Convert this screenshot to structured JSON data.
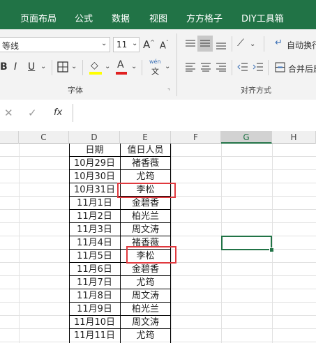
{
  "tabs": [
    "页面布局",
    "公式",
    "数据",
    "视图",
    "方方格子",
    "DIY工具箱"
  ],
  "ribbon": {
    "font_name": "等线",
    "font_size": "11",
    "bold": "B",
    "italic": "I",
    "underline": "U",
    "grow_font": "A",
    "shrink_font": "A",
    "phonetic_top": "wén",
    "phonetic_bottom": "文",
    "font_group_label": "字体",
    "align_group_label": "对齐方式",
    "wrap_text_label": "自动换行",
    "merge_center_label": "合并后居",
    "fill_color": "#ffff00",
    "font_color": "#e02020"
  },
  "formula_bar": {
    "cancel": "✕",
    "enter": "✓",
    "fx": "fx",
    "value": ""
  },
  "grid": {
    "columns": [
      "C",
      "D",
      "E",
      "F",
      "G",
      "H"
    ],
    "header": {
      "date": "日期",
      "person": "值日人员"
    },
    "rows": [
      {
        "date": "10月29日",
        "person": "褚香薇"
      },
      {
        "date": "10月30日",
        "person": "尤筠"
      },
      {
        "date": "10月31日",
        "person": "李松"
      },
      {
        "date": "11月1日",
        "person": "金碧香"
      },
      {
        "date": "11月2日",
        "person": "柏光兰"
      },
      {
        "date": "11月3日",
        "person": "周文涛"
      },
      {
        "date": "11月4日",
        "person": "褚香薇"
      },
      {
        "date": "11月5日",
        "person": "李松"
      },
      {
        "date": "11月6日",
        "person": "金碧香"
      },
      {
        "date": "11月7日",
        "person": "尤筠"
      },
      {
        "date": "11月8日",
        "person": "周文涛"
      },
      {
        "date": "11月9日",
        "person": "柏光兰"
      },
      {
        "date": "11月10日",
        "person": "周文涛"
      },
      {
        "date": "11月11日",
        "person": "尤筠"
      }
    ],
    "selected_cell_column": "G",
    "highlight_color": "#e0393e",
    "selection_color": "#217346"
  }
}
